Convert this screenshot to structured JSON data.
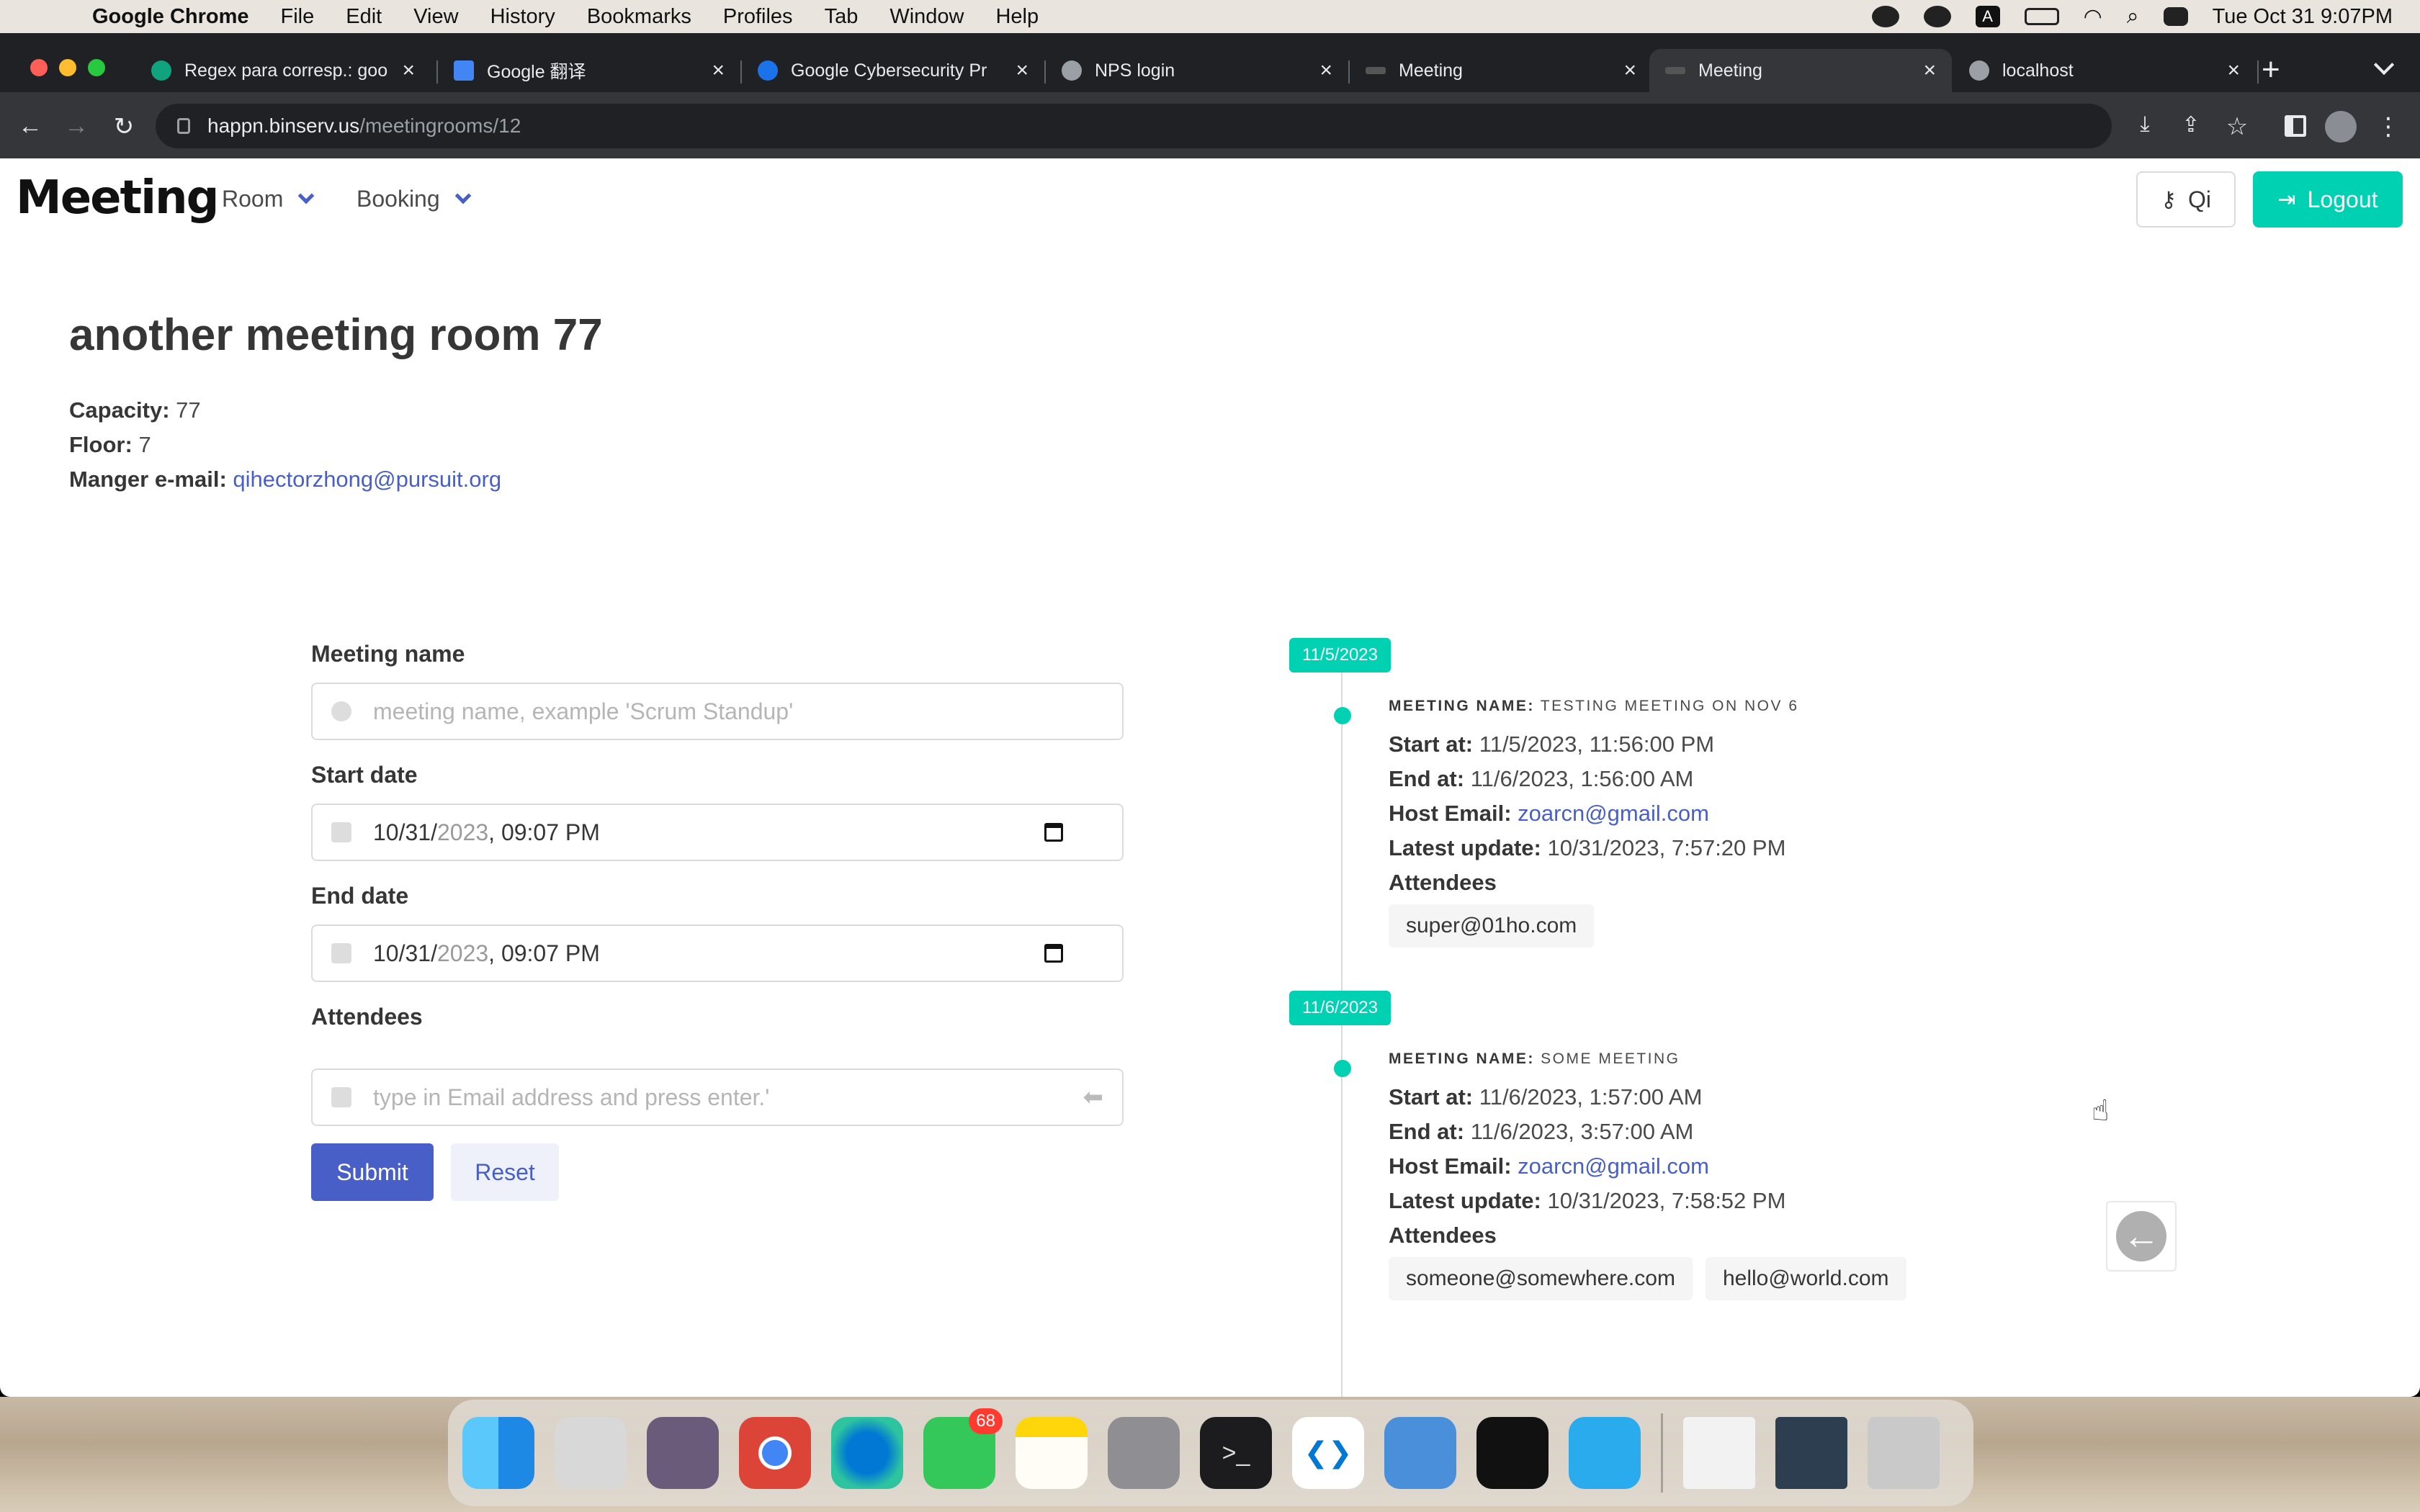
{
  "menubar": {
    "app": "Google Chrome",
    "items": [
      "File",
      "Edit",
      "View",
      "History",
      "Bookmarks",
      "Profiles",
      "Tab",
      "Window",
      "Help"
    ],
    "clock": "Tue Oct 31  9:07PM",
    "icons": [
      "creative-cloud-icon",
      "evernote-icon",
      "input-a-icon",
      "battery-icon",
      "wifi-icon",
      "spotlight-icon",
      "control-center-icon"
    ]
  },
  "browser": {
    "tabs": [
      {
        "title": "Regex para corresp.: goo",
        "active": false
      },
      {
        "title": "Google 翻译",
        "active": false
      },
      {
        "title": "Google Cybersecurity Pr",
        "active": false
      },
      {
        "title": "NPS login",
        "active": false
      },
      {
        "title": "Meeting",
        "active": false
      },
      {
        "title": "Meeting",
        "active": true
      },
      {
        "title": "localhost",
        "active": false
      }
    ],
    "url_host": "happn.binserv.us",
    "url_path": "/meetingrooms/12"
  },
  "navbar": {
    "logo": "Meeting",
    "menu": [
      "Room",
      "Booking"
    ],
    "user_button": "Qi",
    "logout_button": "Logout"
  },
  "room": {
    "title": "another meeting room 77",
    "capacity_label": "Capacity:",
    "capacity": "77",
    "floor_label": "Floor:",
    "floor": "7",
    "manager_label": "Manger e-mail:",
    "manager_email": "qihectorzhong@pursuit.org"
  },
  "form": {
    "name_label": "Meeting name",
    "name_placeholder": "meeting name, example 'Scrum Standup'",
    "start_label": "Start date",
    "start_month_day": "10/31/",
    "start_year": "2023",
    "start_time": ", 09:07 PM",
    "end_label": "End date",
    "end_month_day": "10/31/",
    "end_year": "2023",
    "end_time": ", 09:07 PM",
    "attendees_label": "Attendees",
    "attendees_placeholder": "type in Email address and press enter.'",
    "submit": "Submit",
    "reset": "Reset"
  },
  "bookings": [
    {
      "date_tag": "11/5/2023",
      "name_label": "MEETING NAME:",
      "name": "TESTING MEETING ON NOV 6",
      "start_label": "Start at:",
      "start": "11/5/2023, 11:56:00 PM",
      "end_label": "End at:",
      "end": "11/6/2023, 1:56:00 AM",
      "host_label": "Host Email:",
      "host": "zoarcn@gmail.com",
      "update_label": "Latest update:",
      "update": "10/31/2023, 7:57:20 PM",
      "attendees_label": "Attendees",
      "attendees": [
        "super@01ho.com"
      ]
    },
    {
      "date_tag": "11/6/2023",
      "name_label": "MEETING NAME:",
      "name": "SOME MEETING",
      "start_label": "Start at:",
      "start": "11/6/2023, 1:57:00 AM",
      "end_label": "End at:",
      "end": "11/6/2023, 3:57:00 AM",
      "host_label": "Host Email:",
      "host": "zoarcn@gmail.com",
      "update_label": "Latest update:",
      "update": "10/31/2023, 7:58:52 PM",
      "attendees_label": "Attendees",
      "attendees": [
        "someone@somewhere.com",
        "hello@world.com"
      ]
    }
  ],
  "dock": {
    "apps": [
      "finder",
      "launchpad",
      "affinity",
      "chrome",
      "edge",
      "messages",
      "notes",
      "system-settings",
      "terminal",
      "vscode",
      "tableplus",
      "activity-monitor",
      "telegram"
    ],
    "messages_badge": "68"
  },
  "colors": {
    "primary": "#485fc7",
    "accent": "#00d1b2",
    "text": "#363636"
  }
}
